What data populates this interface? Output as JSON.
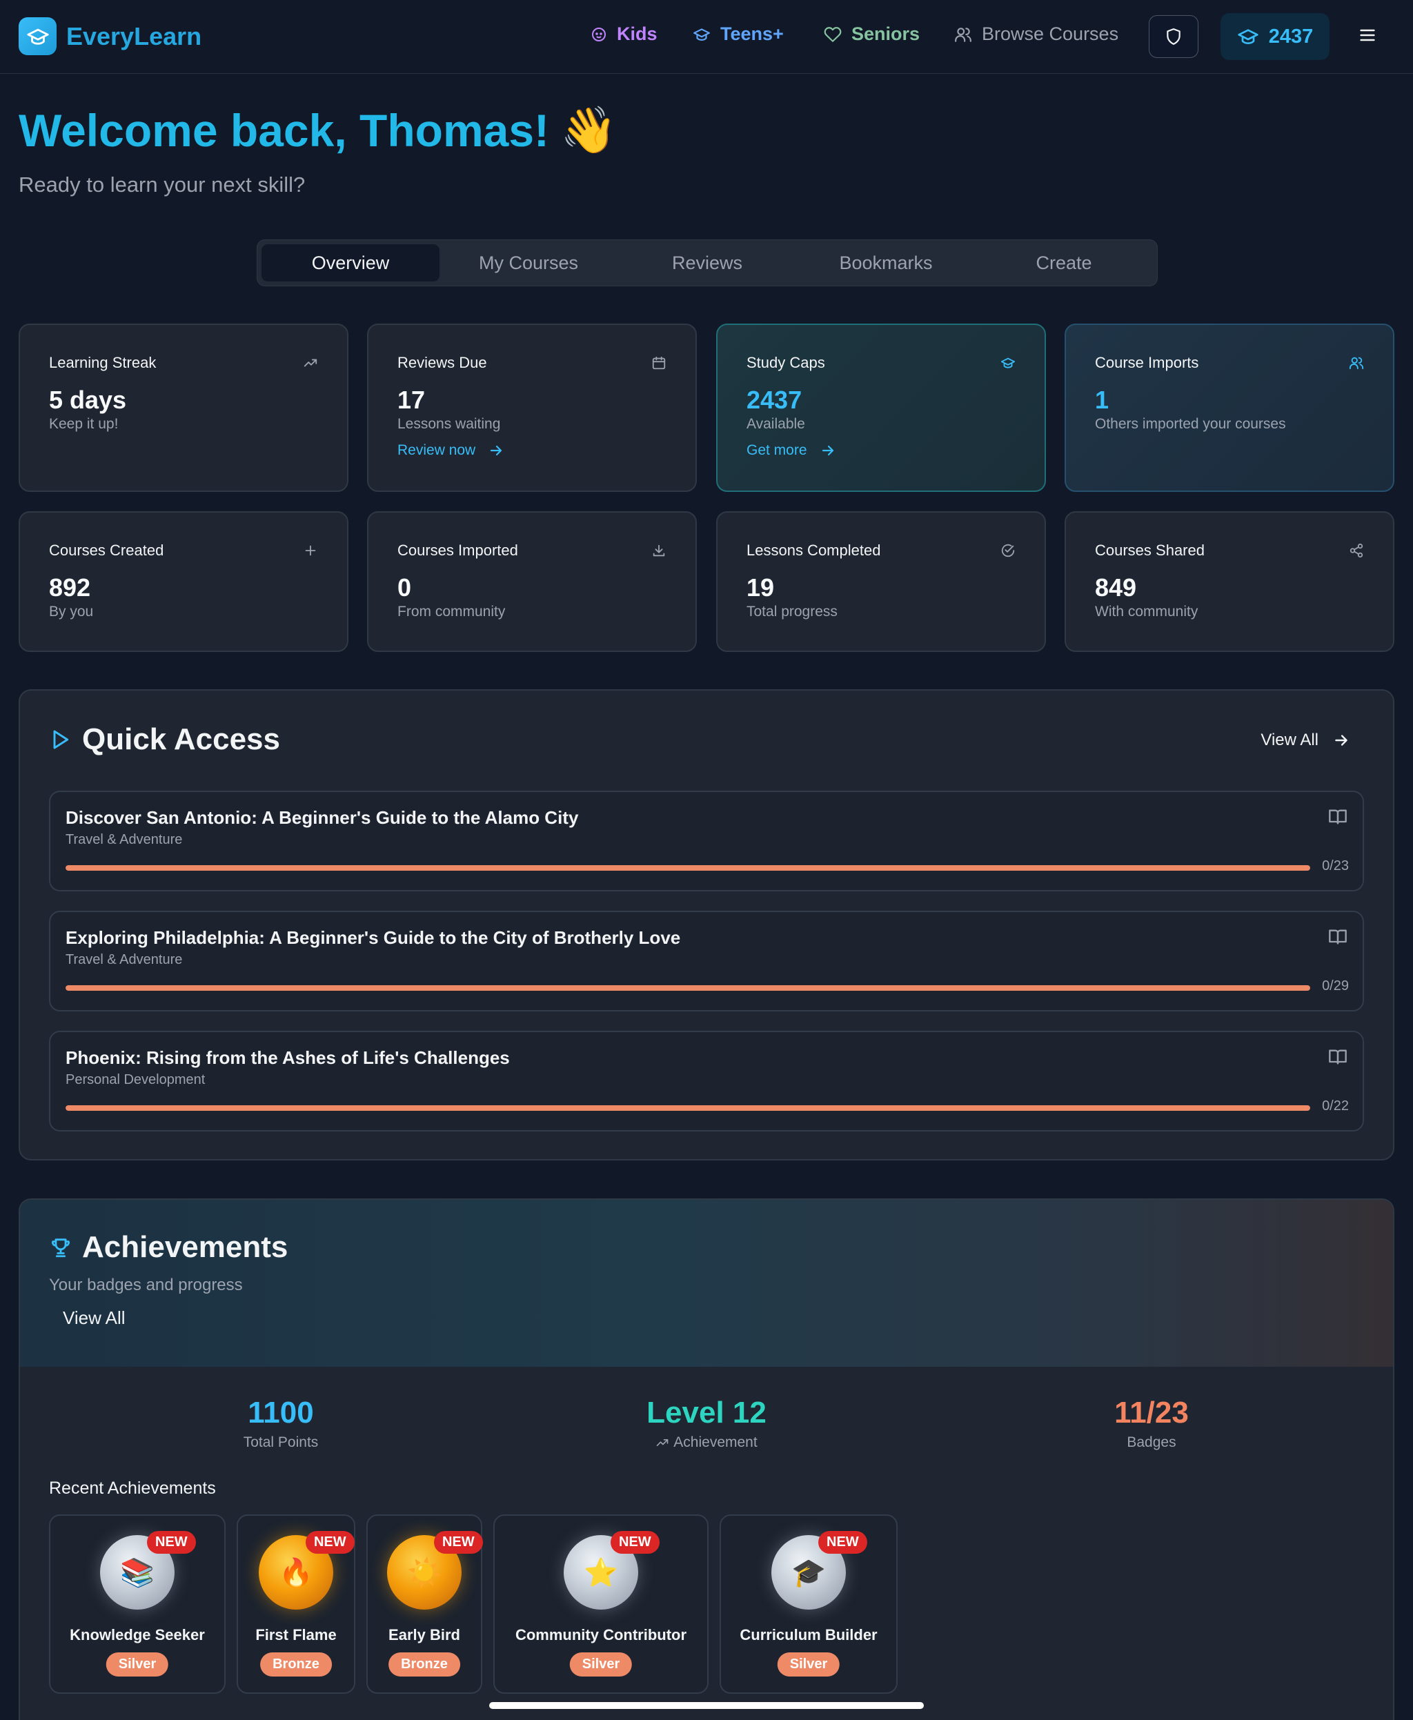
{
  "app": {
    "name": "EveryLearn"
  },
  "nav": {
    "kids": "Kids",
    "teens": "Teens+",
    "seniors": "Seniors",
    "browse": "Browse Courses",
    "caps": "2437"
  },
  "welcome": {
    "title": "Welcome back, Thomas!",
    "emoji": "👋",
    "subtitle": "Ready to learn your next skill?"
  },
  "tabs": [
    "Overview",
    "My Courses",
    "Reviews",
    "Bookmarks",
    "Create"
  ],
  "stats": [
    {
      "title": "Learning Streak",
      "value": "5 days",
      "sub": "Keep it up!",
      "link": "",
      "icon": "trending-up-icon"
    },
    {
      "title": "Reviews Due",
      "value": "17",
      "sub": "Lessons waiting",
      "link": "Review now",
      "icon": "calendar-icon"
    },
    {
      "title": "Study Caps",
      "value": "2437",
      "sub": "Available",
      "link": "Get more",
      "icon": "graduation-cap-icon"
    },
    {
      "title": "Course Imports",
      "value": "1",
      "sub": "Others imported your courses",
      "link": "",
      "icon": "users-icon"
    },
    {
      "title": "Courses Created",
      "value": "892",
      "sub": "By you",
      "link": "",
      "icon": "plus-icon"
    },
    {
      "title": "Courses Imported",
      "value": "0",
      "sub": "From community",
      "link": "",
      "icon": "download-icon"
    },
    {
      "title": "Lessons Completed",
      "value": "19",
      "sub": "Total progress",
      "link": "",
      "icon": "check-circle-icon"
    },
    {
      "title": "Courses Shared",
      "value": "849",
      "sub": "With community",
      "link": "",
      "icon": "share-icon"
    }
  ],
  "quick_access": {
    "title": "Quick Access",
    "view_all": "View All",
    "courses": [
      {
        "name": "Discover San Antonio: A Beginner's Guide to the Alamo City",
        "category": "Travel & Adventure",
        "progress": "0/23"
      },
      {
        "name": "Exploring Philadelphia: A Beginner's Guide to the City of Brotherly Love",
        "category": "Travel & Adventure",
        "progress": "0/29"
      },
      {
        "name": "Phoenix: Rising from the Ashes of Life's Challenges",
        "category": "Personal Development",
        "progress": "0/22"
      }
    ]
  },
  "achievements": {
    "title": "Achievements",
    "subtitle": "Your badges and progress",
    "view_all": "View All",
    "total_points": "1100",
    "total_points_label": "Total Points",
    "level": "Level 12",
    "level_label": "Achievement",
    "badges_count": "11/23",
    "badges_label": "Badges",
    "recent_title": "Recent Achievements",
    "new_label": "NEW",
    "recent": [
      {
        "name": "Knowledge Seeker",
        "tier": "Silver",
        "emoji": "📚"
      },
      {
        "name": "First Flame",
        "tier": "Bronze",
        "emoji": "🔥"
      },
      {
        "name": "Early Bird",
        "tier": "Bronze",
        "emoji": "☀️"
      },
      {
        "name": "Community Contributor",
        "tier": "Silver",
        "emoji": "⭐"
      },
      {
        "name": "Curriculum Builder",
        "tier": "Silver",
        "emoji": "🎓"
      }
    ]
  },
  "colors": {
    "accent": "#38bdf8",
    "progress": "#ef8a66",
    "new_badge": "#dc2626",
    "level": "#2dd4bf",
    "badges": "#f4845f"
  }
}
